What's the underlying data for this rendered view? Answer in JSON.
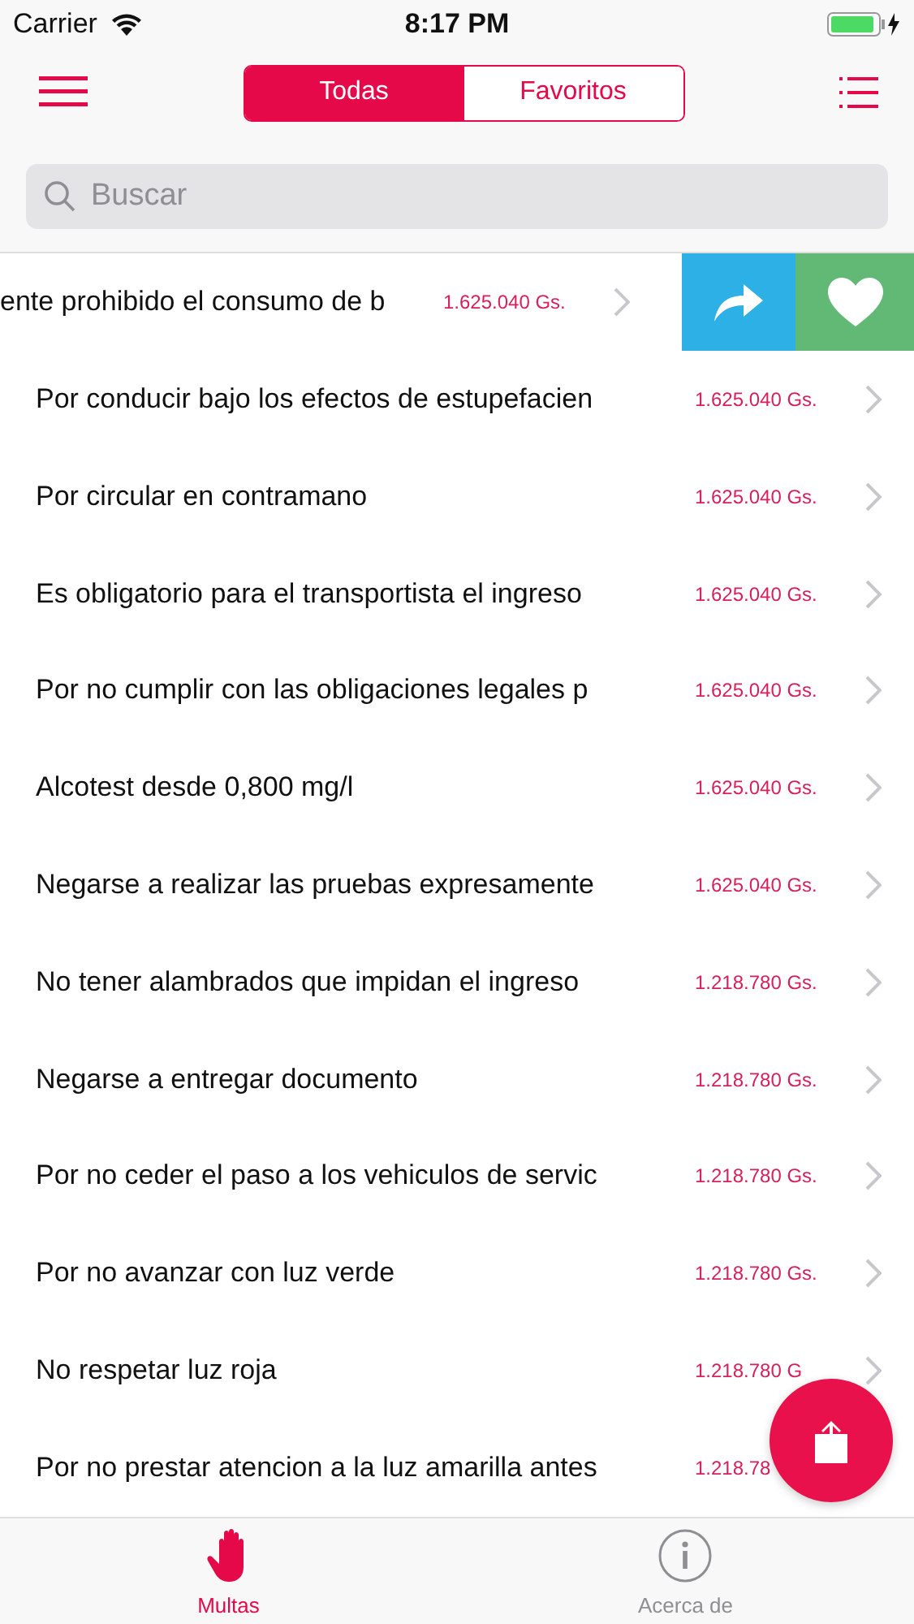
{
  "status_bar": {
    "carrier": "Carrier",
    "time": "8:17 PM"
  },
  "nav": {
    "segments": [
      {
        "label": "Todas",
        "selected": true
      },
      {
        "label": "Favoritos",
        "selected": false
      }
    ]
  },
  "search": {
    "placeholder": "Buscar"
  },
  "rows": [
    {
      "title": "ente prohibido el consumo de b",
      "amount": "1.625.040 Gs.",
      "swiped": true
    },
    {
      "title": "Por conducir bajo los efectos de estupefacien",
      "amount": "1.625.040 Gs.",
      "swiped": false
    },
    {
      "title": "Por circular en contramano",
      "amount": "1.625.040 Gs.",
      "swiped": false
    },
    {
      "title": "Es obligatorio para el transportista el ingreso",
      "amount": "1.625.040 Gs.",
      "swiped": false
    },
    {
      "title": "Por no cumplir con las obligaciones legales p",
      "amount": "1.625.040 Gs.",
      "swiped": false
    },
    {
      "title": "Alcotest desde 0,800 mg/l",
      "amount": "1.625.040 Gs.",
      "swiped": false
    },
    {
      "title": "Negarse a realizar las pruebas expresamente",
      "amount": "1.625.040 Gs.",
      "swiped": false
    },
    {
      "title": "No tener alambrados que impidan el ingreso",
      "amount": "1.218.780 Gs.",
      "swiped": false
    },
    {
      "title": "Negarse a entregar documento",
      "amount": "1.218.780 Gs.",
      "swiped": false
    },
    {
      "title": "Por no ceder el paso a los vehiculos de servic",
      "amount": "1.218.780 Gs.",
      "swiped": false
    },
    {
      "title": "Por no avanzar con luz verde",
      "amount": "1.218.780 Gs.",
      "swiped": false
    },
    {
      "title": "No respetar luz roja",
      "amount": "1.218.780 G",
      "swiped": false
    },
    {
      "title": "Por no prestar atencion a la luz amarilla antes",
      "amount": "1.218.78",
      "swiped": false
    }
  ],
  "tab_bar": [
    {
      "label": "Multas",
      "selected": true,
      "kind": "hand"
    },
    {
      "label": "Acerca de",
      "selected": false,
      "kind": "info"
    }
  ]
}
